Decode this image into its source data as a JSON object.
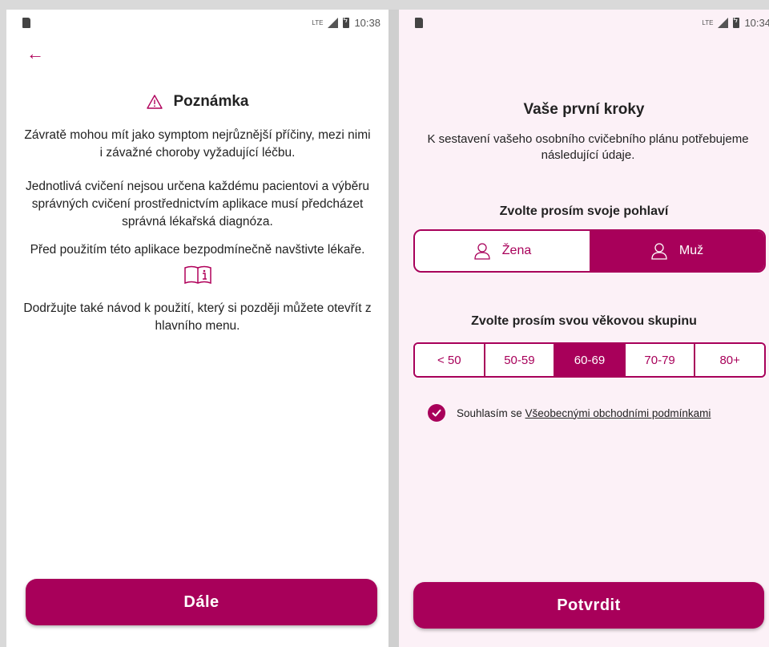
{
  "screen1": {
    "status": {
      "network": "LTE",
      "time": "10:38"
    },
    "title": "Poznámka",
    "paragraphs": [
      "Závratě mohou mít jako symptom nejrůznější příčiny, mezi nimi i závažné choroby vyžadující léčbu.",
      "Jednotlivá cvičení nejsou určena každému pacientovi a výběru správných cvičení prostřednictvím aplikace musí předcházet správná lékařská diagnóza.",
      "Před použitím této aplikace bezpodmínečně navštivte lékaře.",
      "Dodržujte také návod k použití, který si později můžete otevřít z hlavního menu."
    ],
    "button_label": "Dále"
  },
  "screen2": {
    "status": {
      "network": "LTE",
      "time": "10:34"
    },
    "title": "Vaše první kroky",
    "subtitle": "K sestavení vašeho osobního cvičebního plánu potřebujeme následující údaje.",
    "gender_label": "Zvolte prosím svoje pohlaví",
    "gender_options": [
      "Žena",
      "Muž"
    ],
    "gender_selected": "Muž",
    "age_label": "Zvolte prosím svou věkovou skupinu",
    "age_options": [
      "< 50",
      "50-59",
      "60-69",
      "70-79",
      "80+"
    ],
    "age_selected": "60-69",
    "consent_text": "Souhlasím se ",
    "consent_link": "Všeobecnými obchodními podmínkami",
    "consent_checked": true,
    "button_label": "Potvrdit"
  },
  "colors": {
    "accent": "#a8005a",
    "screen2_bg": "#fcf1f7"
  }
}
